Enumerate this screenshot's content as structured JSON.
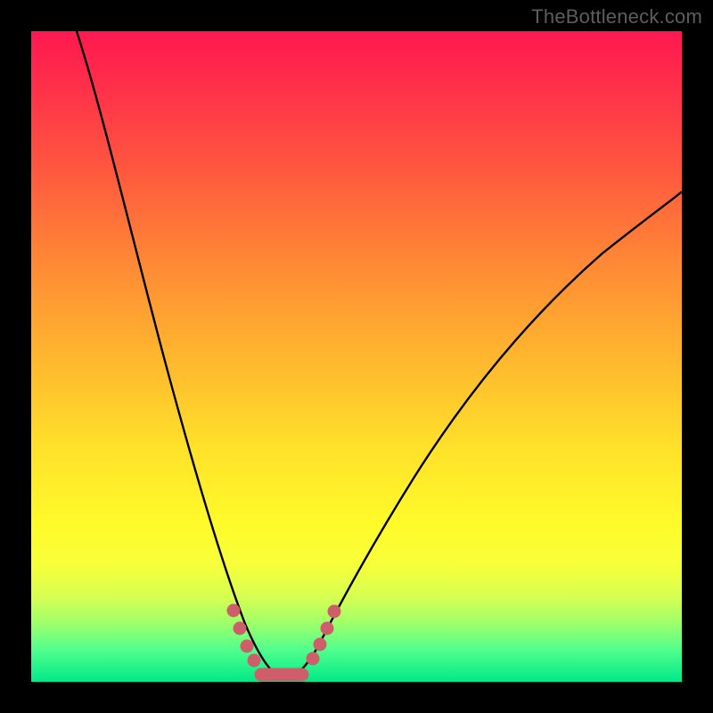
{
  "watermark": "TheBottleneck.com",
  "colors": {
    "frame": "#000000",
    "curve": "#000000",
    "markers": "#cd5e6a",
    "gradient_stops": [
      "#ff1850",
      "#ff5a3e",
      "#ffb62e",
      "#fffb2a",
      "#52ff8c",
      "#00e989"
    ]
  },
  "chart_data": {
    "type": "line",
    "title": "",
    "xlabel": "",
    "ylabel": "",
    "xlim": [
      0,
      100
    ],
    "ylim": [
      0,
      100
    ],
    "grid": false,
    "legend": false,
    "note": "V-shaped curve; y ≈ 0 at the minimum near x ≈ 35–40; axes have no visible ticks or numeric labels, so values are normalized percentages read from geometry.",
    "series": [
      {
        "name": "curve",
        "x": [
          7,
          10,
          14,
          18,
          22,
          26,
          30,
          33,
          35,
          37,
          40,
          43,
          46,
          50,
          55,
          60,
          66,
          74,
          82,
          90,
          98,
          100
        ],
        "y": [
          100,
          88,
          72,
          56,
          41,
          28,
          17,
          9,
          4,
          1,
          0,
          1,
          4,
          9,
          15,
          22,
          30,
          40,
          50,
          58,
          66,
          68
        ]
      }
    ],
    "markers": {
      "name": "highlighted-points",
      "note": "salmon dots clustered around the trough",
      "x": [
        30.5,
        31.5,
        33,
        35,
        37,
        39,
        41,
        42.5,
        44,
        45.5
      ],
      "y": [
        10,
        6,
        3,
        0.8,
        0.3,
        0.3,
        0.8,
        3,
        6,
        9
      ]
    }
  }
}
